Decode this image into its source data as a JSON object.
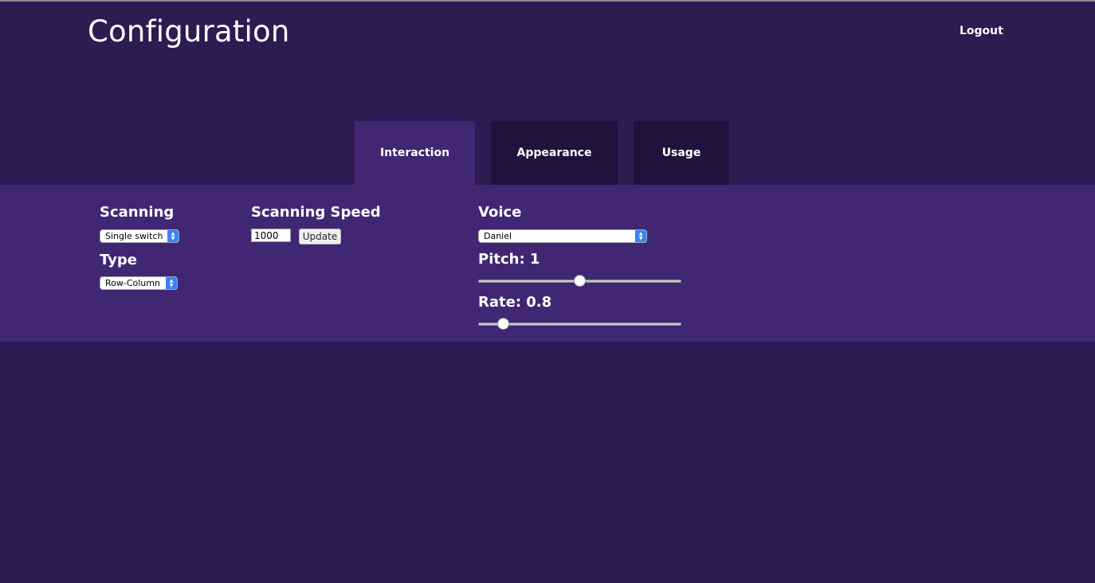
{
  "header": {
    "title": "Configuration",
    "logout_label": "Logout"
  },
  "tabs": [
    {
      "label": "Interaction",
      "active": true
    },
    {
      "label": "Appearance",
      "active": false
    },
    {
      "label": "Usage",
      "active": false
    }
  ],
  "interaction": {
    "scanning": {
      "label": "Scanning",
      "selected": "Single switch"
    },
    "type": {
      "label": "Type",
      "selected": "Row-Column"
    },
    "scanning_speed": {
      "label": "Scanning Speed",
      "value": "1000",
      "update_label": "Update"
    },
    "voice": {
      "label": "Voice",
      "selected": "Daniel"
    },
    "pitch": {
      "label": "Pitch: 1",
      "value": 1,
      "fraction": 0.5
    },
    "rate": {
      "label": "Rate: 0.8",
      "value": 0.8,
      "fraction": 0.1
    }
  },
  "colors": {
    "background": "#2e1b52",
    "panel": "#412674",
    "inactive_tab": "#21123d",
    "select_accent": "#3a82f7"
  },
  "icons": {
    "select_stepper": "chevron-up-down-icon"
  }
}
